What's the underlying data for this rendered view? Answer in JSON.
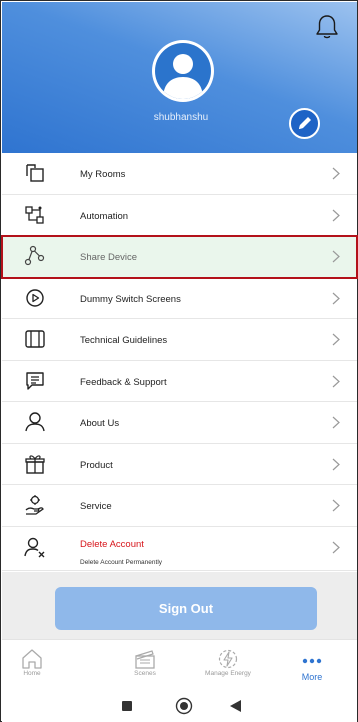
{
  "profile": {
    "username": "shubhanshu"
  },
  "menu": {
    "items": [
      {
        "label": "My Rooms",
        "icon": "rooms-icon"
      },
      {
        "label": "Automation",
        "icon": "automation-icon"
      },
      {
        "label": "Share Device",
        "icon": "share-device-icon",
        "highlighted": true
      },
      {
        "label": "Dummy Switch Screens",
        "icon": "play-circle-icon"
      },
      {
        "label": "Technical Guidelines",
        "icon": "book-icon"
      },
      {
        "label": "Feedback & Support",
        "icon": "feedback-icon"
      },
      {
        "label": "About Us",
        "icon": "person-icon"
      },
      {
        "label": "Product",
        "icon": "gift-icon"
      },
      {
        "label": "Service",
        "icon": "service-icon"
      }
    ],
    "delete_account": {
      "label": "Delete Account",
      "sublabel": "Delete Account Permanently",
      "icon": "delete-user-icon"
    }
  },
  "signout": {
    "label": "Sign Out"
  },
  "tabbar": {
    "tabs": [
      {
        "label": "Home",
        "icon": "home-icon"
      },
      {
        "label": "Scenes",
        "icon": "clapper-icon"
      },
      {
        "label": "Manage Energy",
        "icon": "energy-icon"
      },
      {
        "label": "More",
        "icon": "more-dots-icon",
        "active": true
      }
    ]
  },
  "colors": {
    "header_gradient_start": "#9cc2ef",
    "header_gradient_end": "#2f74d0",
    "accent": "#2f74d0",
    "danger": "#d7151b",
    "highlight_border": "#b3111a",
    "signout_button": "#8fb8ea"
  }
}
